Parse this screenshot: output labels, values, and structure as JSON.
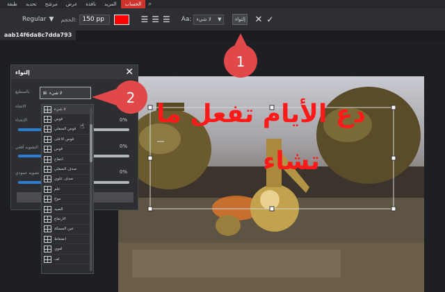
{
  "menubar": {
    "items": [
      "طبقة",
      "تحديد",
      "مرشح",
      "عرض",
      "نافذة",
      "المزيد",
      "الحساب"
    ],
    "active_index": 6
  },
  "toolbar": {
    "font_weight": "Regular",
    "size_label": "الحجم:",
    "font_size": "150 pp",
    "text_color": "#ff0000",
    "aa_label": "Aa:",
    "antialias_value": "لا شيء",
    "warp_button_label": "إلتواء"
  },
  "document": {
    "tab_title": "aab14f6da8c7dda793"
  },
  "canvas": {
    "text_line1": "دع الأيام تفعل ما",
    "text_line2": "تشاء"
  },
  "dialog": {
    "title": "إلتواء",
    "style_label": "بالسطيع",
    "style_value": "لا شيء",
    "direction_label": "الاتجاه",
    "bend_label": "الإنحناء",
    "bend_value": "0%",
    "hdistort_label": "التشويه أفقي",
    "hdistort_value": "0%",
    "vdistort_label": "تشويه عمودي",
    "vdistort_value": "0%"
  },
  "dropdown": {
    "items": [
      "لا شيء",
      "قوس",
      "قوس السفلي",
      "قوس الاعلى",
      "قوس",
      "انتفاخ",
      "صدف السفلي",
      "صدف علوي",
      "علم",
      "موج",
      "الصيد",
      "الارتفاع",
      "عين السمكة",
      "انضغاط",
      "لفوي",
      "لف"
    ],
    "selected_index": 0
  },
  "callouts": {
    "one": "1",
    "two": "2"
  },
  "colors": {
    "accent": "#d0332c",
    "callout": "#e0484a",
    "slider_fill": "#2c7fd0"
  }
}
